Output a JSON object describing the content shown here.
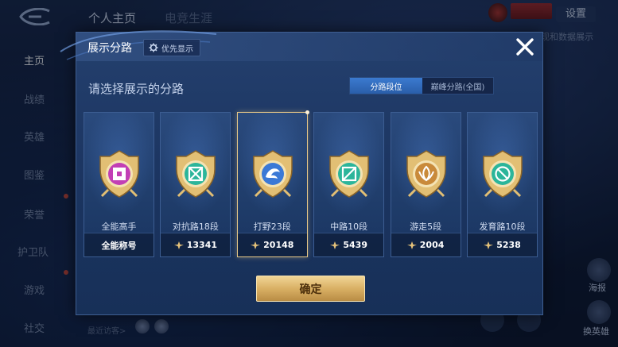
{
  "background": {
    "tabs": [
      "个人主页",
      "电竞生涯"
    ],
    "settings_label": "设置",
    "right_link": "现和数据展示",
    "side_nav": [
      "主页",
      "战绩",
      "英雄",
      "图鉴",
      "荣誉",
      "护卫队",
      "游戏",
      "社交"
    ],
    "recent_visitors": "最近访客>",
    "right_buttons": [
      "海报",
      "换英雄"
    ]
  },
  "modal": {
    "title": "展示分路",
    "priority_label": "优先显示",
    "subtitle": "请选择展示的分路",
    "segments": [
      {
        "label": "分路段位",
        "active": true
      },
      {
        "label": "巅峰分路(全国)",
        "active": false
      }
    ],
    "cards": [
      {
        "label": "全能高手",
        "value": "全能称号",
        "medal_color": "#c23fb5",
        "icon": "all-round-icon",
        "selected": false,
        "has_star": false
      },
      {
        "label": "对抗路18段",
        "value": "13341",
        "medal_color": "#2bb59a",
        "icon": "clash-lane-icon",
        "selected": false,
        "has_star": true
      },
      {
        "label": "打野23段",
        "value": "20148",
        "medal_color": "#3b79d6",
        "icon": "jungle-icon",
        "selected": true,
        "has_star": true
      },
      {
        "label": "中路10段",
        "value": "5439",
        "medal_color": "#2bb59a",
        "icon": "mid-lane-icon",
        "selected": false,
        "has_star": true
      },
      {
        "label": "游走5段",
        "value": "2004",
        "medal_color": "#c98a3a",
        "icon": "roam-icon",
        "selected": false,
        "has_star": true
      },
      {
        "label": "发育路10段",
        "value": "5238",
        "medal_color": "#2bb59a",
        "icon": "farm-lane-icon",
        "selected": false,
        "has_star": true
      }
    ],
    "confirm_label": "确定"
  }
}
